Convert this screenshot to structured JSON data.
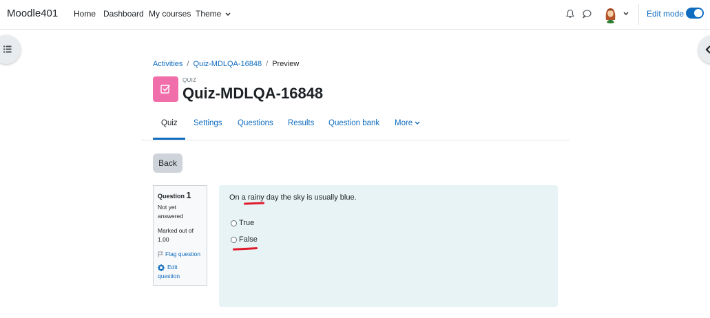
{
  "navbar": {
    "brand": "Moodle401",
    "links": [
      "Home",
      "Dashboard",
      "My courses",
      "Theme"
    ],
    "theme_chevron": "⌄",
    "edit_mode_label": "Edit mode",
    "edit_mode_on": true,
    "icons": [
      "bell-icon",
      "chat-icon",
      "user-avatar",
      "chevron-down-icon"
    ]
  },
  "breadcrumb": {
    "items": [
      "Activities",
      "Quiz-MDLQA-16848",
      "Preview"
    ],
    "separator": "/"
  },
  "header": {
    "kicker": "QUIZ",
    "title": "Quiz-MDLQA-16848",
    "icon_color": "#f06eaa"
  },
  "tabs": [
    "Quiz",
    "Settings",
    "Questions",
    "Results",
    "Question bank",
    "More"
  ],
  "back_label": "Back",
  "question": {
    "label": "Question",
    "number": "1",
    "status_line1": "Not yet",
    "status_line2": "answered",
    "marked_line1": "Marked out of",
    "marked_line2": "1.00",
    "flag_label": "Flag question",
    "edit_line1": "Edit",
    "edit_line2": "question",
    "text": "On a rainy day the sky is usually blue.",
    "options": [
      "True",
      "False"
    ]
  },
  "colors": {
    "accent": "#0f6cbf",
    "annotation": "#e0192b",
    "question_bg": "#e7f3f5"
  }
}
